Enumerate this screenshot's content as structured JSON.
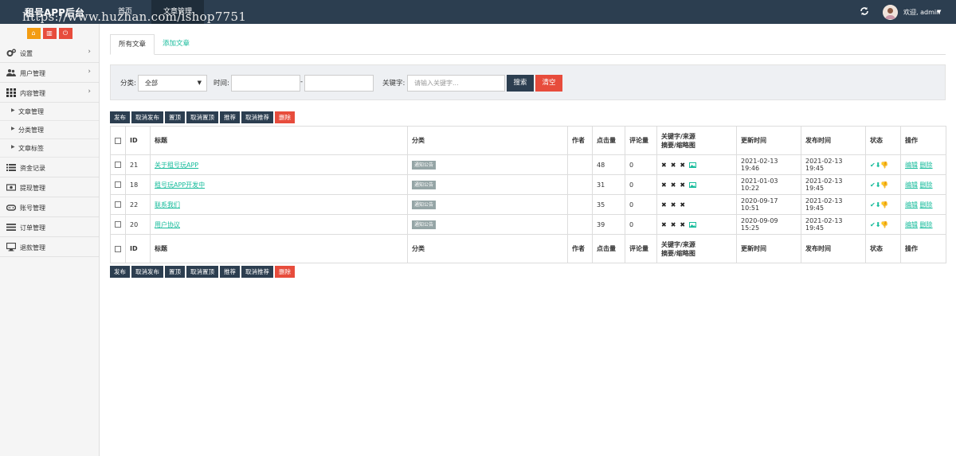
{
  "header": {
    "brand": "租号APP后台",
    "watermark": "https://www.huzhan.com/ishop7751",
    "nav": [
      "首页",
      "文章管理"
    ],
    "welcome": "欢迎, admin"
  },
  "sidebar": {
    "shortcut_icons": [
      "home-icon",
      "trash-icon",
      "power-icon"
    ],
    "menu": [
      {
        "label": "设置",
        "icon": "gears-icon"
      },
      {
        "label": "用户管理",
        "icon": "users-icon"
      },
      {
        "label": "内容管理",
        "icon": "grid-icon"
      },
      {
        "label": "资金记录",
        "icon": "list-icon"
      },
      {
        "label": "提现管理",
        "icon": "money-icon"
      },
      {
        "label": "账号管理",
        "icon": "gamepad-icon"
      },
      {
        "label": "订单管理",
        "icon": "bars-icon"
      },
      {
        "label": "退款管理",
        "icon": "desktop-icon"
      }
    ],
    "submenu": [
      "文章管理",
      "分类管理",
      "文章标签"
    ]
  },
  "tabs": [
    "所有文章",
    "添加文章"
  ],
  "filter": {
    "category_label": "分类:",
    "category_value": "全部",
    "time_label": "时间:",
    "time_sep": "-",
    "keyword_label": "关键字:",
    "keyword_placeholder": "请输入关键字...",
    "search_label": "搜索",
    "clear_label": "清空"
  },
  "toolbar": [
    "发布",
    "取消发布",
    "置顶",
    "取消置顶",
    "推荐",
    "取消推荐",
    "删除"
  ],
  "table": {
    "columns": [
      "ID",
      "标题",
      "分类",
      "作者",
      "点击量",
      "评论量",
      "关键字/来源\n摘要/缩略图",
      "更新时间",
      "发布时间",
      "状态",
      "操作"
    ],
    "col_keyword_line1": "关键字/来源",
    "col_keyword_line2": "摘要/缩略图",
    "rows": [
      {
        "id": "21",
        "title": "关于租号玩APP",
        "category": "通知公告",
        "author": "",
        "clicks": "48",
        "comments": "0",
        "has_thumb": true,
        "updated": "2021-02-13 19:46",
        "published": "2021-02-13 19:45"
      },
      {
        "id": "18",
        "title": "租号玩APP开发中",
        "category": "通知公告",
        "author": "",
        "clicks": "31",
        "comments": "0",
        "has_thumb": true,
        "updated": "2021-01-03 10:22",
        "published": "2021-02-13 19:45"
      },
      {
        "id": "22",
        "title": "联系我们",
        "category": "通知公告",
        "author": "",
        "clicks": "35",
        "comments": "0",
        "has_thumb": false,
        "updated": "2020-09-17 10:51",
        "published": "2021-02-13 19:45"
      },
      {
        "id": "20",
        "title": "用户协议",
        "category": "通知公告",
        "author": "",
        "clicks": "39",
        "comments": "0",
        "has_thumb": true,
        "updated": "2020-09-09 15:25",
        "published": "2021-02-13 19:45"
      }
    ],
    "row_actions": [
      "编辑",
      "删除"
    ],
    "x_mark": "✖",
    "status_icons": "✔⬇👎"
  },
  "colors": {
    "topbar": "#2c3e50",
    "accent": "#18bc9c",
    "danger": "#e74c3c",
    "shortcut": "#f39c12"
  }
}
